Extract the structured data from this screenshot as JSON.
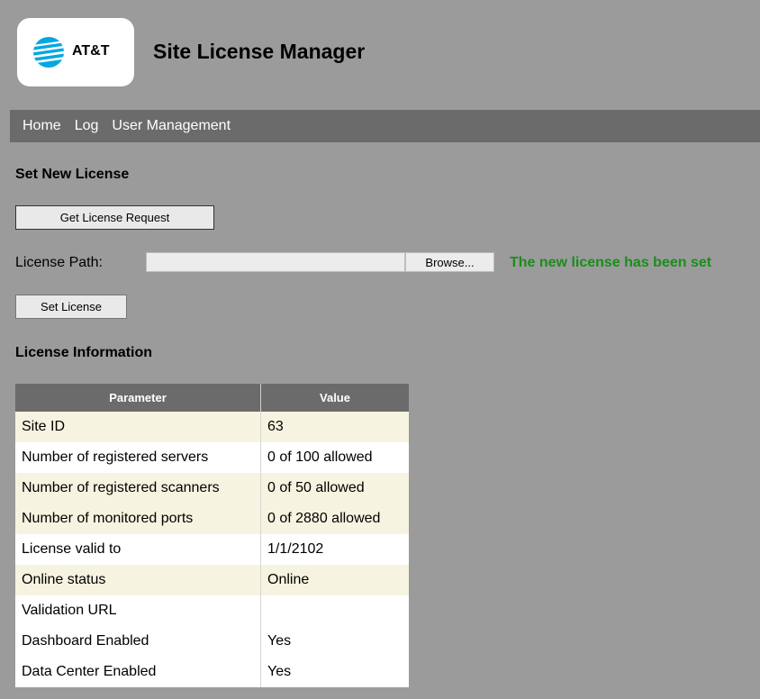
{
  "header": {
    "logo_text": "AT&T",
    "title": "Site License Manager"
  },
  "nav": {
    "items": [
      "Home",
      "Log",
      "User Management"
    ]
  },
  "set_license": {
    "section_title": "Set New License",
    "get_request_label": "Get License Request",
    "path_label": "License Path:",
    "path_value": "",
    "browse_label": "Browse...",
    "status_message": "The new license has been set",
    "set_license_label": "Set License"
  },
  "license_info": {
    "section_title": "License Information",
    "columns": [
      "Parameter",
      "Value"
    ],
    "rows": [
      {
        "param": "Site ID",
        "value": "63"
      },
      {
        "param": "Number of registered servers",
        "value": "0 of 100 allowed"
      },
      {
        "param": "Number of registered scanners",
        "value": "0 of 50 allowed"
      },
      {
        "param": "Number of monitored ports",
        "value": "0 of 2880 allowed"
      },
      {
        "param": "License valid to",
        "value": "1/1/2102"
      },
      {
        "param": "Online status",
        "value": "Online"
      },
      {
        "param": "Validation URL",
        "value": ""
      },
      {
        "param": "Dashboard Enabled",
        "value": "Yes"
      },
      {
        "param": "Data Center Enabled",
        "value": "Yes"
      }
    ]
  },
  "colors": {
    "background": "#9b9b9b",
    "nav_bar": "#6b6b6b",
    "success_text": "#1c8c1c",
    "row_highlight": "#f6f4e0",
    "brand_blue": "#00a8e0"
  },
  "icons": {
    "logo": "att-globe-icon"
  }
}
